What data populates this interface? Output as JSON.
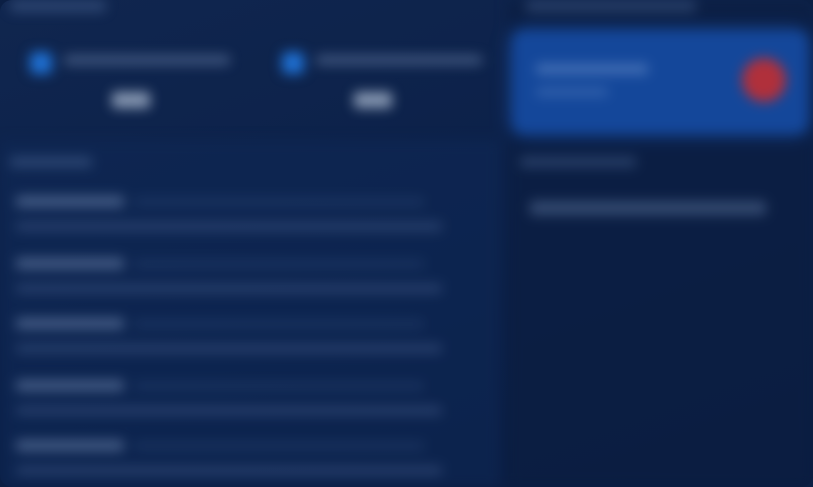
{
  "header": {
    "title": ""
  },
  "stats": [
    {
      "icon": "stat-icon",
      "label": "",
      "value": ""
    },
    {
      "icon": "stat-icon",
      "label": "",
      "value": ""
    }
  ],
  "list": {
    "title": "",
    "items": [
      {
        "title": "",
        "meta": "",
        "description": ""
      },
      {
        "title": "",
        "meta": "",
        "description": ""
      },
      {
        "title": "",
        "meta": "",
        "description": ""
      },
      {
        "title": "",
        "meta": "",
        "description": ""
      },
      {
        "title": "",
        "meta": "",
        "description": ""
      }
    ]
  },
  "sidebar": {
    "header": "",
    "alert": {
      "title": "",
      "subtitle": "",
      "icon": "alert-icon",
      "icon_color": "#b0303b"
    },
    "section_title": "",
    "items": [
      {
        "label": ""
      }
    ]
  },
  "colors": {
    "background": "#0b1f44",
    "accent": "#1f6fd1",
    "card": "#14479a",
    "danger": "#b0303b"
  }
}
